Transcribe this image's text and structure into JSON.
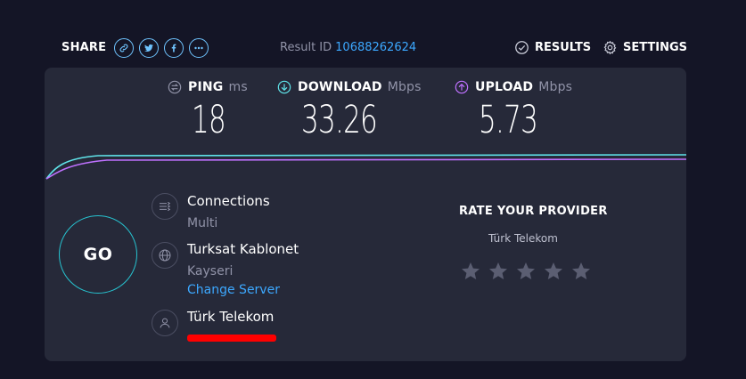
{
  "header": {
    "share_label": "SHARE",
    "share_buttons": [
      "link-icon",
      "twitter-icon",
      "facebook-icon",
      "more-icon"
    ],
    "result_id_label": "Result ID",
    "result_id_value": "10688262624",
    "results_label": "RESULTS",
    "settings_label": "SETTINGS"
  },
  "metrics": {
    "ping": {
      "label": "PING",
      "unit": "ms",
      "value": "18",
      "icon": "ping-icon",
      "color": "#9193a8"
    },
    "download": {
      "label": "DOWNLOAD",
      "unit": "Mbps",
      "value": "33.26",
      "icon": "download-arrow-icon",
      "color": "#5fe3e9"
    },
    "upload": {
      "label": "UPLOAD",
      "unit": "Mbps",
      "value": "5.73",
      "icon": "upload-arrow-icon",
      "color": "#bf71ff"
    }
  },
  "go_label": "GO",
  "connection": {
    "title": "Connections",
    "mode": "Multi",
    "server_name": "Turksat Kablonet",
    "server_location": "Kayseri",
    "change_server_label": "Change Server",
    "isp_name": "Türk Telekom"
  },
  "rating": {
    "title": "RATE YOUR PROVIDER",
    "provider": "Türk Telekom",
    "stars_total": 5,
    "stars_selected": 0
  },
  "colors": {
    "background": "#141526",
    "panel": "#262939",
    "accent_blue": "#3ca8ff",
    "go_ring": "#27c3d0"
  }
}
